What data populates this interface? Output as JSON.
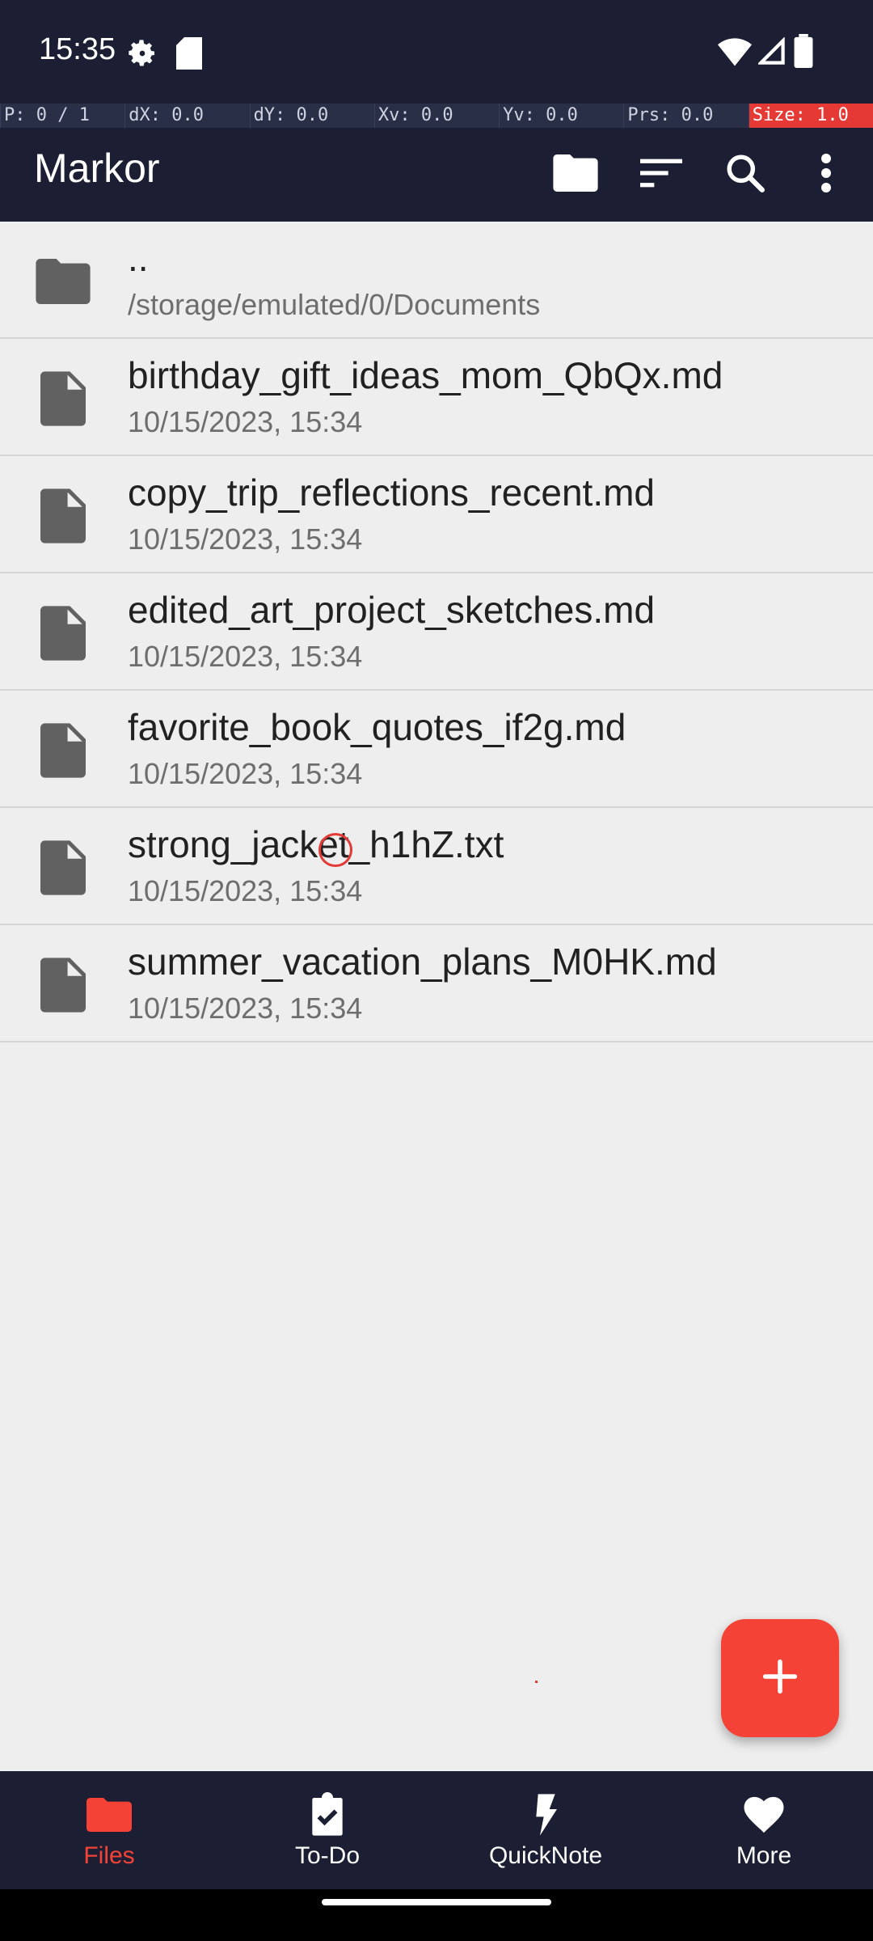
{
  "status_bar": {
    "time": "15:35",
    "icons": [
      "settings-icon",
      "sd-card-icon",
      "wifi-icon",
      "signal-icon",
      "battery-icon"
    ]
  },
  "pointer_bar": {
    "cells": [
      "P: 0 / 1",
      "dX: 0.0",
      "dY: 0.0",
      "Xv: 0.0",
      "Yv: 0.0",
      "Prs: 0.0",
      "Size: 1.0"
    ]
  },
  "app_bar": {
    "title": "Markor",
    "actions": [
      "folder-icon",
      "sort-icon",
      "search-icon",
      "more-vert-icon"
    ]
  },
  "files": [
    {
      "name": "..",
      "subtitle": "/storage/emulated/0/Documents",
      "type": "folder"
    },
    {
      "name": "birthday_gift_ideas_mom_QbQx.md",
      "subtitle": "10/15/2023, 15:34",
      "type": "file"
    },
    {
      "name": "copy_trip_reflections_recent.md",
      "subtitle": "10/15/2023, 15:34",
      "type": "file"
    },
    {
      "name": "edited_art_project_sketches.md",
      "subtitle": "10/15/2023, 15:34",
      "type": "file"
    },
    {
      "name": "favorite_book_quotes_if2g.md",
      "subtitle": "10/15/2023, 15:34",
      "type": "file"
    },
    {
      "name": "strong_jacket_h1hZ.txt",
      "subtitle": "10/15/2023, 15:34",
      "type": "file"
    },
    {
      "name": "summer_vacation_plans_M0HK.md",
      "subtitle": "10/15/2023, 15:34",
      "type": "file"
    }
  ],
  "bottom_nav": {
    "items": [
      {
        "label": "Files",
        "icon": "folder-icon",
        "active": true
      },
      {
        "label": "To-Do",
        "icon": "clipboard-check-icon",
        "active": false
      },
      {
        "label": "QuickNote",
        "icon": "flash-icon",
        "active": false
      },
      {
        "label": "More",
        "icon": "heart-icon",
        "active": false
      }
    ]
  },
  "colors": {
    "bar_background": "#1c1f33",
    "accent": "#f44336",
    "list_background": "#eeeeee"
  }
}
